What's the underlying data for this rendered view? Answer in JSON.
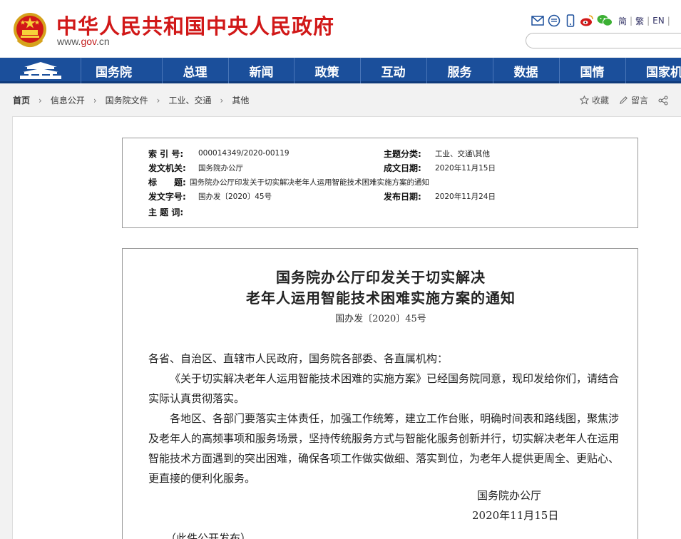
{
  "header": {
    "site_title": "中华人民共和国中央人民政府",
    "domain_prefix": "www.",
    "domain_main": "gov",
    "domain_suffix": ".cn",
    "lang_simplified": "简",
    "lang_traditional": "繁",
    "lang_english": "EN",
    "lang_sep": "|",
    "search_placeholder": ""
  },
  "nav": {
    "items": [
      "国务院",
      "总理",
      "新闻",
      "政策",
      "互动",
      "服务",
      "数据",
      "国情",
      "国家机构"
    ]
  },
  "breadcrumb": {
    "items": [
      "首页",
      "信息公开",
      "国务院文件",
      "工业、交通",
      "其他"
    ],
    "sep": "›"
  },
  "actions": {
    "favorite": "收藏",
    "comment": "留言"
  },
  "meta": {
    "index_label": "索 引 号:",
    "index_value": "000014349/2020-00119",
    "category_label": "主题分类:",
    "category_value": "工业、交通\\其他",
    "issuer_label": "发文机关:",
    "issuer_value": "国务院办公厅",
    "created_label": "成文日期:",
    "created_value": "2020年11月15日",
    "title_label": "标　　题:",
    "title_value": "国务院办公厅印发关于切实解决老年人运用智能技术困难实施方案的通知",
    "docnum_label": "发文字号:",
    "docnum_value": "国办发〔2020〕45号",
    "published_label": "发布日期:",
    "published_value": "2020年11月24日",
    "keywords_label": "主 题 词:",
    "keywords_value": ""
  },
  "document": {
    "title_line1": "国务院办公厅印发关于切实解决",
    "title_line2": "老年人运用智能技术困难实施方案的通知",
    "doc_number": "国办发〔2020〕45号",
    "salutation": "各省、自治区、直辖市人民政府，国务院各部委、各直属机构：",
    "paragraph1": "《关于切实解决老年人运用智能技术困难的实施方案》已经国务院同意，现印发给你们，请结合实际认真贯彻落实。",
    "paragraph2": "各地区、各部门要落实主体责任，加强工作统筹，建立工作台账，明确时间表和路线图，聚焦涉及老年人的高频事项和服务场景，坚持传统服务方式与智能化服务创新并行，切实解决老年人在运用智能技术方面遇到的突出困难，确保各项工作做实做细、落实到位，为老年人提供更周全、更贴心、更直接的便利化服务。",
    "signature": "国务院办公厅",
    "sign_date": "2020年11月15日",
    "publish_note": "（此件公开发布）"
  },
  "colors": {
    "title_red": "#d11818",
    "nav_blue": "#1b4f9b"
  }
}
